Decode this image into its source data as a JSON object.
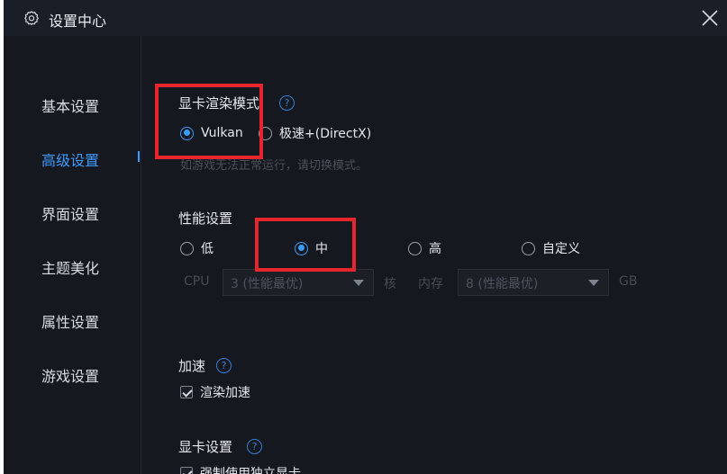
{
  "window": {
    "title": "设置中心"
  },
  "sidebar": {
    "items": [
      {
        "label": "基本设置",
        "active": false
      },
      {
        "label": "高级设置",
        "active": true
      },
      {
        "label": "界面设置",
        "active": false
      },
      {
        "label": "主题美化",
        "active": false
      },
      {
        "label": "属性设置",
        "active": false
      },
      {
        "label": "游戏设置",
        "active": false
      }
    ]
  },
  "render_mode": {
    "title": "显卡渲染模式",
    "options": [
      {
        "label": "Vulkan",
        "checked": true
      },
      {
        "label": "极速+(DirectX)",
        "checked": false
      }
    ],
    "hint": "如游戏无法正常运行，请切换模式。"
  },
  "performance": {
    "title": "性能设置",
    "options": [
      {
        "label": "低",
        "checked": false
      },
      {
        "label": "中",
        "checked": true
      },
      {
        "label": "高",
        "checked": false
      },
      {
        "label": "自定义",
        "checked": false
      }
    ],
    "cpu_label": "CPU",
    "cpu_value": "3 (性能最优)",
    "cpu_unit": "核",
    "mem_label": "内存",
    "mem_value": "8 (性能最优)",
    "mem_unit": "GB"
  },
  "acceleration": {
    "title": "加速",
    "checkbox_label": "渲染加速",
    "checked": true
  },
  "gpu": {
    "title": "显卡设置",
    "checkbox_label": "强制使用独立显卡",
    "checked": true
  },
  "help_glyph": "?",
  "colors": {
    "accent": "#3b9bff",
    "background": "#15181e",
    "highlight_box": "#e6262c"
  }
}
